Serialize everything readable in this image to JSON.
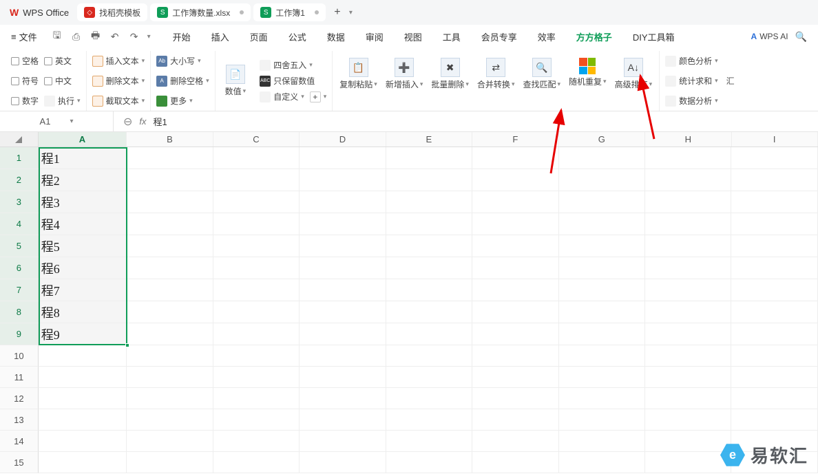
{
  "app": {
    "name": "WPS Office"
  },
  "tabs": [
    {
      "label": "找稻壳模板",
      "badge": "r",
      "badgeText": "◇"
    },
    {
      "label": "工作簿数量.xlsx",
      "badge": "g",
      "badgeText": "S",
      "dot": true
    },
    {
      "label": "工作簿1",
      "badge": "g",
      "badgeText": "S",
      "dot": true
    }
  ],
  "menu": {
    "file": "文件",
    "tabs": [
      "开始",
      "插入",
      "页面",
      "公式",
      "数据",
      "审阅",
      "视图",
      "工具",
      "会员专享",
      "效率",
      "方方格子",
      "DIY工具箱"
    ],
    "activeTab": "方方格子",
    "ai": "WPS AI"
  },
  "ribbon": {
    "checks1": [
      "空格",
      "符号",
      "数字"
    ],
    "checks2": [
      "英文",
      "中文",
      "执行"
    ],
    "textOps": [
      "插入文本",
      "删除文本",
      "截取文本"
    ],
    "caseOps": {
      "case": "大小写",
      "delSpace": "删除空格",
      "more": "更多"
    },
    "numGroup": {
      "num": "数值",
      "round": "四舍五入",
      "keepNum": "只保留数值",
      "custom": "自定义",
      "plus": "+"
    },
    "bigButtons": [
      "复制粘贴",
      "新增插入",
      "批量删除",
      "合并转换",
      "查找匹配",
      "随机重复",
      "高级排序"
    ],
    "rightCol": [
      "颜色分析",
      "统计求和",
      "数据分析"
    ],
    "edgeLabel": "汇"
  },
  "nameBox": "A1",
  "formula": "程1",
  "columns": [
    "A",
    "B",
    "C",
    "D",
    "E",
    "F",
    "G",
    "H",
    "I"
  ],
  "colWidths": {
    "A": 129,
    "other": 126
  },
  "rows": [
    {
      "n": 1,
      "A": "程1"
    },
    {
      "n": 2,
      "A": "程2"
    },
    {
      "n": 3,
      "A": "程3"
    },
    {
      "n": 4,
      "A": "程4"
    },
    {
      "n": 5,
      "A": "程5"
    },
    {
      "n": 6,
      "A": "程6"
    },
    {
      "n": 7,
      "A": "程7"
    },
    {
      "n": 8,
      "A": "程8"
    },
    {
      "n": 9,
      "A": "程9"
    },
    {
      "n": 10
    },
    {
      "n": 11
    },
    {
      "n": 12
    },
    {
      "n": 13
    },
    {
      "n": 14
    },
    {
      "n": 15
    }
  ],
  "selection": {
    "col": "A",
    "rowStart": 1,
    "rowEnd": 9
  },
  "watermark": {
    "text": "易软汇",
    "icon": "e"
  }
}
